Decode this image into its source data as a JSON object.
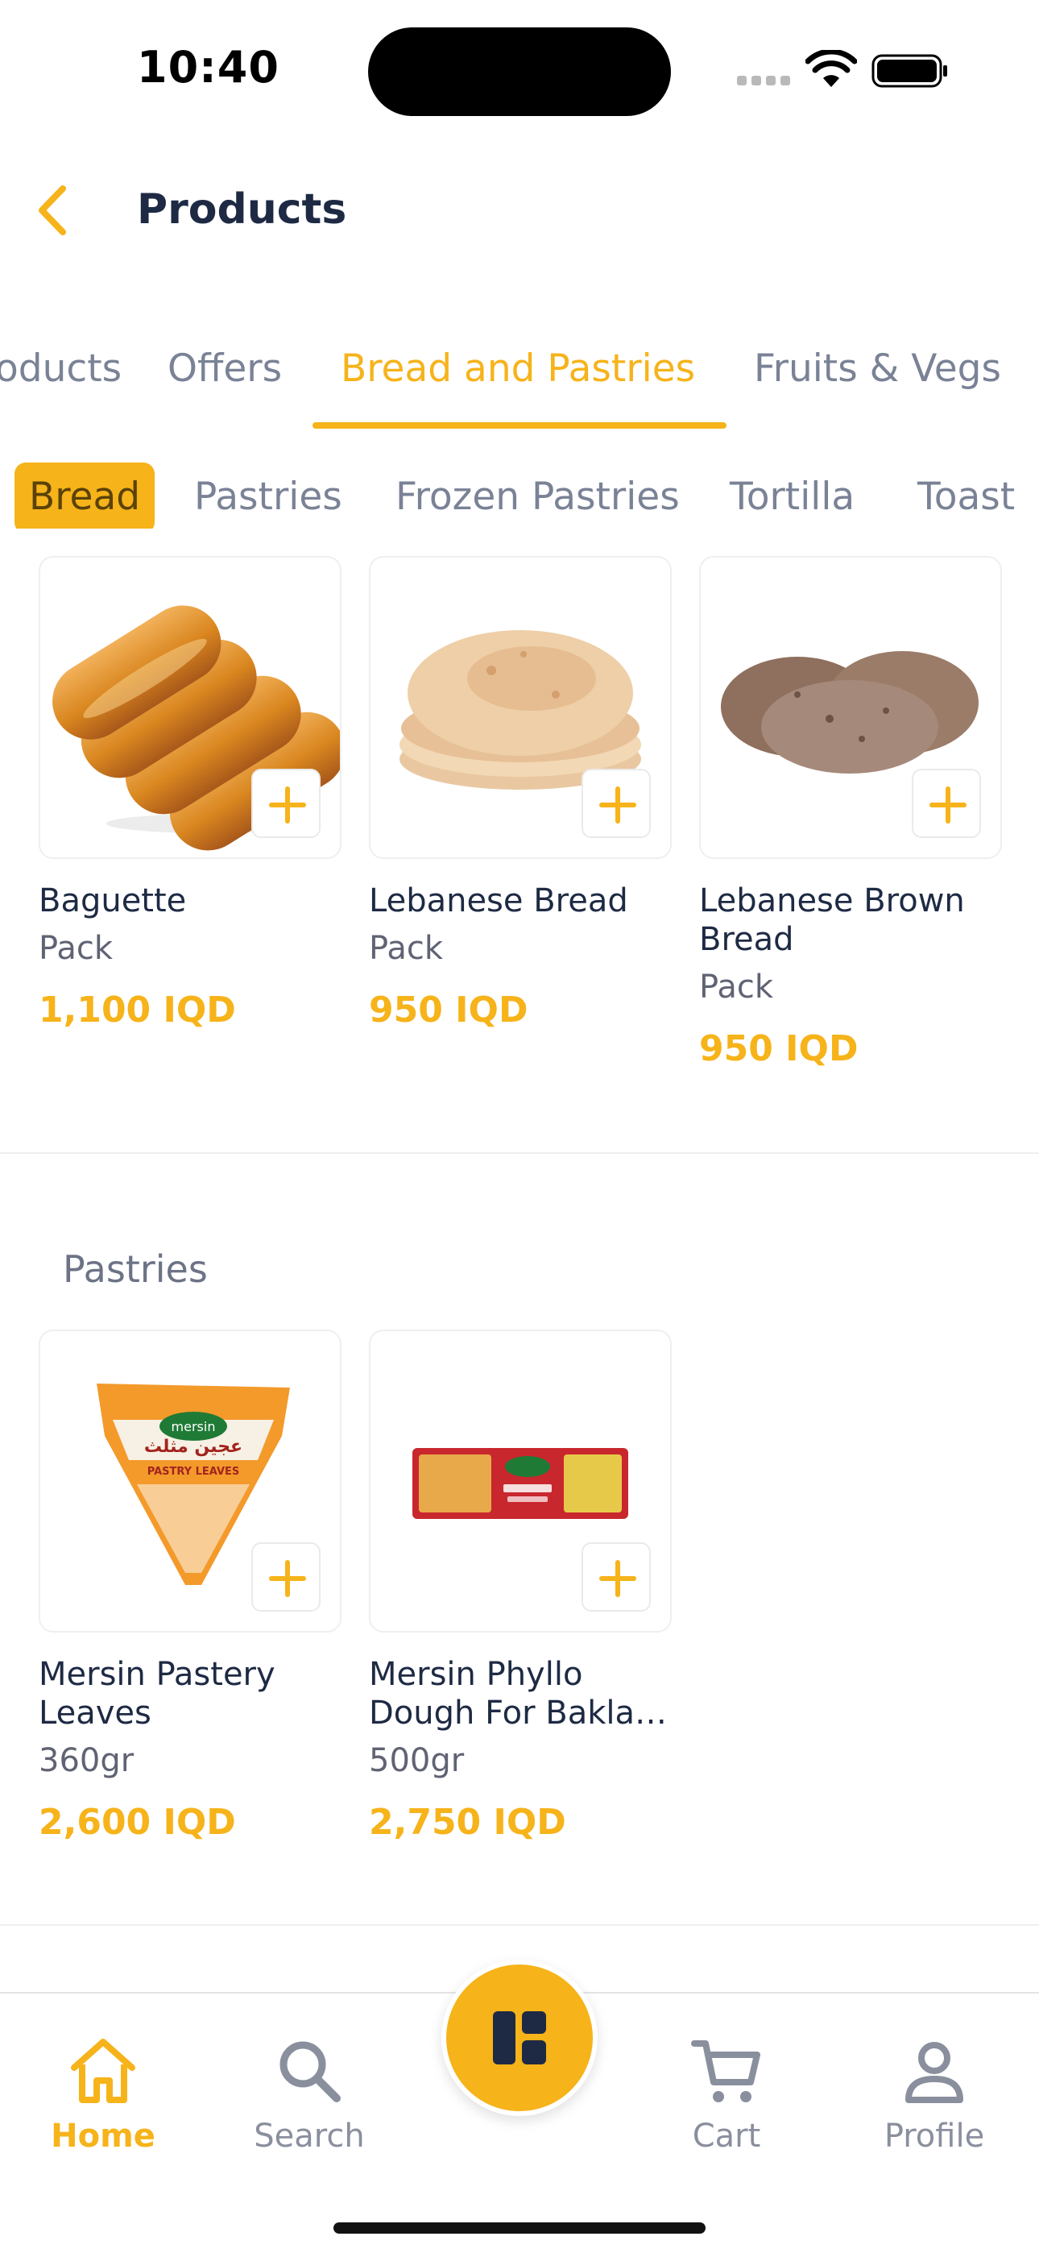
{
  "status_bar": {
    "time": "10:40",
    "icons": [
      "cellular-signal-icon",
      "wifi-icon",
      "battery-icon"
    ]
  },
  "header": {
    "title": "Products",
    "back_icon": "chevron-left-icon"
  },
  "category_tabs": [
    {
      "label": "oducts",
      "active": false
    },
    {
      "label": "Offers",
      "active": false
    },
    {
      "label": "Bread and Pastries",
      "active": true
    },
    {
      "label": "Fruits & Vegs",
      "active": false
    }
  ],
  "sub_tabs": [
    {
      "label": "Bread",
      "active": true
    },
    {
      "label": "Pastries",
      "active": false
    },
    {
      "label": "Frozen Pastries",
      "active": false
    },
    {
      "label": "Tortilla",
      "active": false
    },
    {
      "label": "Toast",
      "active": false
    }
  ],
  "sections": [
    {
      "title": "",
      "products": [
        {
          "name": "Baguette",
          "unit": "Pack",
          "price": "1,100 IQD",
          "image": "bread-rolls-image"
        },
        {
          "name": "Lebanese Bread",
          "unit": "Pack",
          "price": "950 IQD",
          "image": "flatbread-image"
        },
        {
          "name": "Lebanese Brown Bread",
          "unit": "Pack",
          "price": "950 IQD",
          "image": "brown-flatbread-image"
        }
      ]
    },
    {
      "title": "Pastries",
      "products": [
        {
          "name": "Mersin Pastery Leaves",
          "unit": "360gr",
          "price": "2,600 IQD",
          "image": "pastry-leaves-package-image"
        },
        {
          "name": "Mersin Phyllo Dough For Bakla…",
          "unit": "500gr",
          "price": "2,750 IQD",
          "image": "phyllo-dough-package-image"
        }
      ]
    }
  ],
  "package_text": {
    "brand": "mersin",
    "pastry_leaves_arabic": "عجين مثلث",
    "pastry_leaves_english": "PASTRY LEAVES"
  },
  "bottom_nav": [
    {
      "label": "Home",
      "icon": "home-icon",
      "active": true
    },
    {
      "label": "Search",
      "icon": "search-icon",
      "active": false
    },
    {
      "label": "",
      "icon": "categories-grid-icon",
      "active": false
    },
    {
      "label": "Cart",
      "icon": "cart-icon",
      "active": false
    },
    {
      "label": "Profile",
      "icon": "profile-icon",
      "active": false
    }
  ],
  "colors": {
    "accent": "#f6b31a",
    "text_primary": "#1e2a44",
    "text_muted": "#7a8296"
  }
}
